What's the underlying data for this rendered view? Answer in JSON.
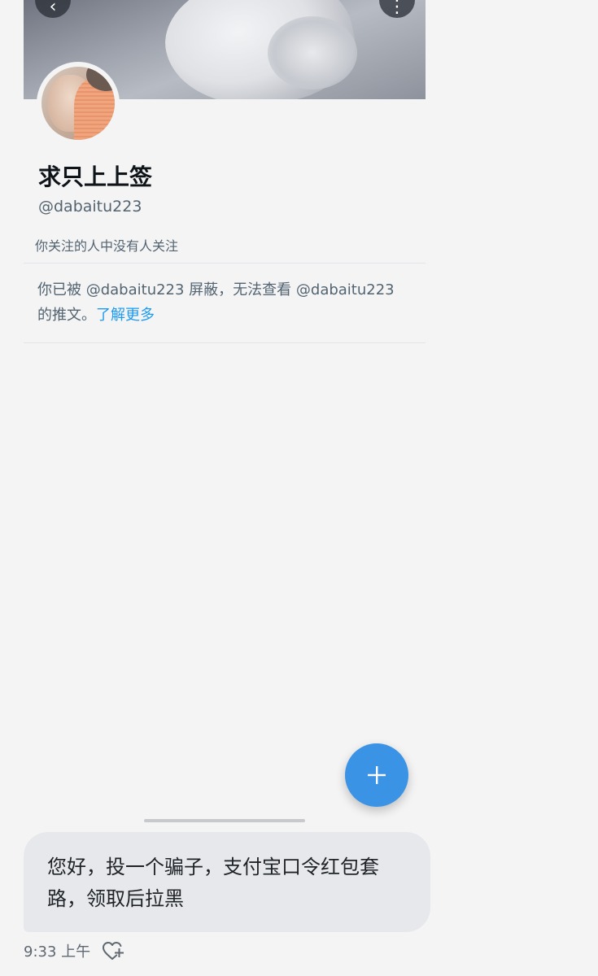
{
  "header": {
    "back_icon": "back-arrow-icon",
    "more_icon": "more-dots-icon"
  },
  "profile": {
    "name": "求只上上签",
    "handle": "@dabaitu223",
    "follow_note": "你关注的人中没有人关注"
  },
  "blocked_notice": {
    "text": "你已被 @dabaitu223 屏蔽，无法查看 @dabaitu223 的推文。",
    "link_label": "了解更多"
  },
  "fab": {
    "icon": "plus-icon",
    "color": "#3b93e6"
  },
  "message": {
    "text": "您好，投一个骗子，支付宝口令红包套路，领取后拉黑",
    "time": "9:33 上午",
    "reaction_icon": "heart-plus-icon"
  },
  "colors": {
    "link": "#1d9bf0",
    "bubble": "#e6e8eb",
    "background": "#f4f4f5"
  }
}
